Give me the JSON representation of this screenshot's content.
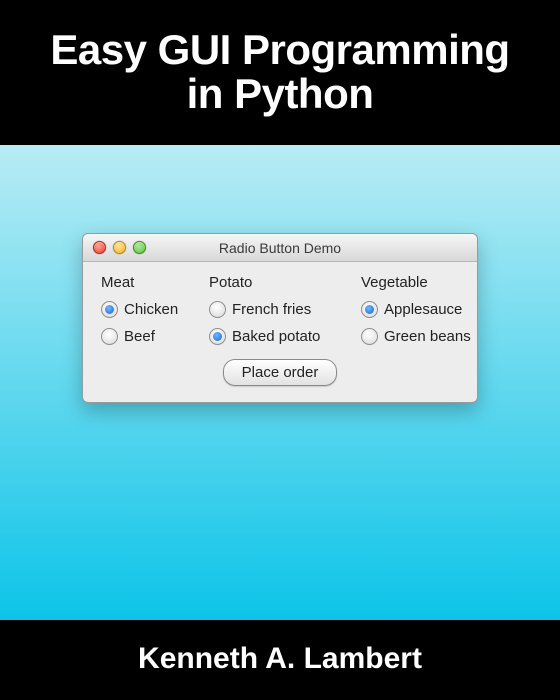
{
  "title": {
    "line1": "Easy GUI Programming",
    "line2": "in Python"
  },
  "author": "Kenneth A. Lambert",
  "window": {
    "title": "Radio Button Demo",
    "columns": {
      "meat": {
        "header": "Meat",
        "options": [
          {
            "label": "Chicken",
            "selected": true
          },
          {
            "label": "Beef",
            "selected": false
          }
        ]
      },
      "potato": {
        "header": "Potato",
        "options": [
          {
            "label": "French fries",
            "selected": false
          },
          {
            "label": "Baked potato",
            "selected": true
          }
        ]
      },
      "vegetable": {
        "header": "Vegetable",
        "options": [
          {
            "label": "Applesauce",
            "selected": true
          },
          {
            "label": "Green beans",
            "selected": false
          }
        ]
      }
    },
    "button_label": "Place order"
  }
}
